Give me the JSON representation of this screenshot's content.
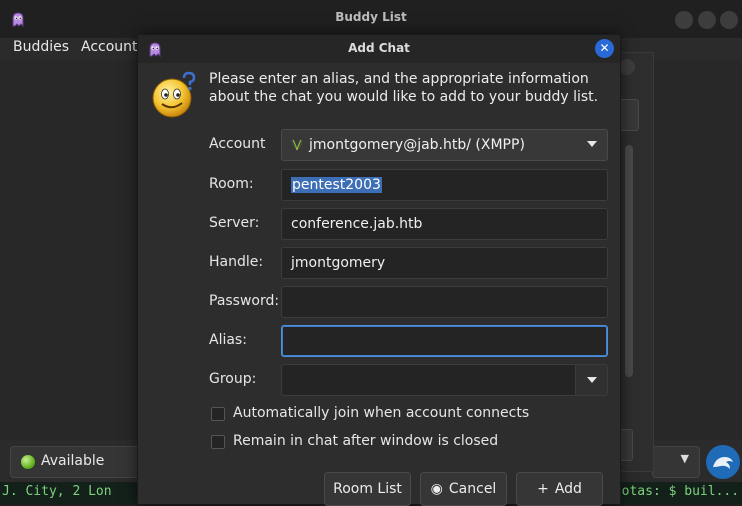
{
  "buddy_window": {
    "title": "Buddy List",
    "menu": [
      "Buddies",
      "Accounts"
    ],
    "status": "Available"
  },
  "terminal": {
    "left_text": "J. City, 2 Lon",
    "right_text": "quotas: $ buil... JAVA_OPTIO"
  },
  "dialog": {
    "title": "Add Chat",
    "close_glyph": "✕",
    "intro": "Please enter an alias, and the appropriate information about the chat you would like to add to your buddy list.",
    "fields": {
      "account": {
        "label": "Account",
        "value": "jmontgomery@jab.htb/ (XMPP)"
      },
      "room": {
        "label": "Room:",
        "value": "pentest2003"
      },
      "server": {
        "label": "Server:",
        "value": "conference.jab.htb"
      },
      "handle": {
        "label": "Handle:",
        "value": "jmontgomery"
      },
      "password": {
        "label": "Password:",
        "value": ""
      },
      "alias": {
        "label": "Alias:",
        "value": ""
      },
      "group": {
        "label": "Group:",
        "value": ""
      }
    },
    "checkboxes": {
      "auto_join": {
        "label": "Automatically join when account connects",
        "checked": false
      },
      "remain": {
        "label": "Remain in chat after window is closed",
        "checked": false
      }
    },
    "buttons": {
      "room_list": "Room List",
      "cancel": "Cancel",
      "add": "Add",
      "cancel_icon": "◉",
      "add_icon": "+"
    }
  },
  "colors": {
    "accent": "#2a6ad8",
    "focus_border": "#4f8fd8",
    "selection": "#3d6fb6",
    "status_green": "#5fae1f"
  },
  "icons": [
    "pidgin-icon",
    "smiley-question-icon",
    "xmpp-icon",
    "available-status-icon",
    "kali-icon",
    "close-icon",
    "chevron-down-icon"
  ]
}
